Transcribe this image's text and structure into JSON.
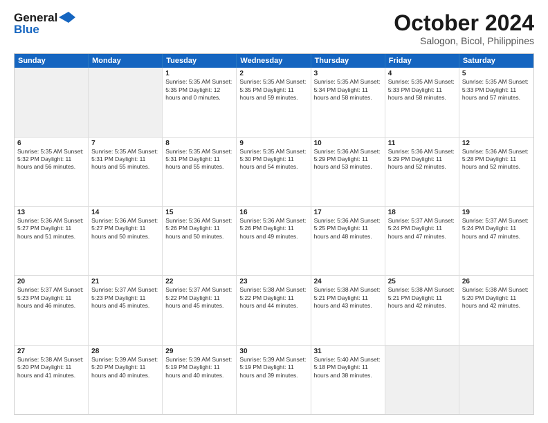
{
  "logo": {
    "line1": "General",
    "line2": "Blue"
  },
  "title": "October 2024",
  "subtitle": "Salogon, Bicol, Philippines",
  "weekdays": [
    "Sunday",
    "Monday",
    "Tuesday",
    "Wednesday",
    "Thursday",
    "Friday",
    "Saturday"
  ],
  "rows": [
    [
      {
        "day": "",
        "text": "",
        "shaded": true
      },
      {
        "day": "",
        "text": "",
        "shaded": true
      },
      {
        "day": "1",
        "text": "Sunrise: 5:35 AM\nSunset: 5:35 PM\nDaylight: 12 hours\nand 0 minutes."
      },
      {
        "day": "2",
        "text": "Sunrise: 5:35 AM\nSunset: 5:35 PM\nDaylight: 11 hours\nand 59 minutes."
      },
      {
        "day": "3",
        "text": "Sunrise: 5:35 AM\nSunset: 5:34 PM\nDaylight: 11 hours\nand 58 minutes."
      },
      {
        "day": "4",
        "text": "Sunrise: 5:35 AM\nSunset: 5:33 PM\nDaylight: 11 hours\nand 58 minutes."
      },
      {
        "day": "5",
        "text": "Sunrise: 5:35 AM\nSunset: 5:33 PM\nDaylight: 11 hours\nand 57 minutes."
      }
    ],
    [
      {
        "day": "6",
        "text": "Sunrise: 5:35 AM\nSunset: 5:32 PM\nDaylight: 11 hours\nand 56 minutes."
      },
      {
        "day": "7",
        "text": "Sunrise: 5:35 AM\nSunset: 5:31 PM\nDaylight: 11 hours\nand 55 minutes."
      },
      {
        "day": "8",
        "text": "Sunrise: 5:35 AM\nSunset: 5:31 PM\nDaylight: 11 hours\nand 55 minutes."
      },
      {
        "day": "9",
        "text": "Sunrise: 5:35 AM\nSunset: 5:30 PM\nDaylight: 11 hours\nand 54 minutes."
      },
      {
        "day": "10",
        "text": "Sunrise: 5:36 AM\nSunset: 5:29 PM\nDaylight: 11 hours\nand 53 minutes."
      },
      {
        "day": "11",
        "text": "Sunrise: 5:36 AM\nSunset: 5:29 PM\nDaylight: 11 hours\nand 52 minutes."
      },
      {
        "day": "12",
        "text": "Sunrise: 5:36 AM\nSunset: 5:28 PM\nDaylight: 11 hours\nand 52 minutes."
      }
    ],
    [
      {
        "day": "13",
        "text": "Sunrise: 5:36 AM\nSunset: 5:27 PM\nDaylight: 11 hours\nand 51 minutes."
      },
      {
        "day": "14",
        "text": "Sunrise: 5:36 AM\nSunset: 5:27 PM\nDaylight: 11 hours\nand 50 minutes."
      },
      {
        "day": "15",
        "text": "Sunrise: 5:36 AM\nSunset: 5:26 PM\nDaylight: 11 hours\nand 50 minutes."
      },
      {
        "day": "16",
        "text": "Sunrise: 5:36 AM\nSunset: 5:26 PM\nDaylight: 11 hours\nand 49 minutes."
      },
      {
        "day": "17",
        "text": "Sunrise: 5:36 AM\nSunset: 5:25 PM\nDaylight: 11 hours\nand 48 minutes."
      },
      {
        "day": "18",
        "text": "Sunrise: 5:37 AM\nSunset: 5:24 PM\nDaylight: 11 hours\nand 47 minutes."
      },
      {
        "day": "19",
        "text": "Sunrise: 5:37 AM\nSunset: 5:24 PM\nDaylight: 11 hours\nand 47 minutes."
      }
    ],
    [
      {
        "day": "20",
        "text": "Sunrise: 5:37 AM\nSunset: 5:23 PM\nDaylight: 11 hours\nand 46 minutes."
      },
      {
        "day": "21",
        "text": "Sunrise: 5:37 AM\nSunset: 5:23 PM\nDaylight: 11 hours\nand 45 minutes."
      },
      {
        "day": "22",
        "text": "Sunrise: 5:37 AM\nSunset: 5:22 PM\nDaylight: 11 hours\nand 45 minutes."
      },
      {
        "day": "23",
        "text": "Sunrise: 5:38 AM\nSunset: 5:22 PM\nDaylight: 11 hours\nand 44 minutes."
      },
      {
        "day": "24",
        "text": "Sunrise: 5:38 AM\nSunset: 5:21 PM\nDaylight: 11 hours\nand 43 minutes."
      },
      {
        "day": "25",
        "text": "Sunrise: 5:38 AM\nSunset: 5:21 PM\nDaylight: 11 hours\nand 42 minutes."
      },
      {
        "day": "26",
        "text": "Sunrise: 5:38 AM\nSunset: 5:20 PM\nDaylight: 11 hours\nand 42 minutes."
      }
    ],
    [
      {
        "day": "27",
        "text": "Sunrise: 5:38 AM\nSunset: 5:20 PM\nDaylight: 11 hours\nand 41 minutes."
      },
      {
        "day": "28",
        "text": "Sunrise: 5:39 AM\nSunset: 5:20 PM\nDaylight: 11 hours\nand 40 minutes."
      },
      {
        "day": "29",
        "text": "Sunrise: 5:39 AM\nSunset: 5:19 PM\nDaylight: 11 hours\nand 40 minutes."
      },
      {
        "day": "30",
        "text": "Sunrise: 5:39 AM\nSunset: 5:19 PM\nDaylight: 11 hours\nand 39 minutes."
      },
      {
        "day": "31",
        "text": "Sunrise: 5:40 AM\nSunset: 5:18 PM\nDaylight: 11 hours\nand 38 minutes."
      },
      {
        "day": "",
        "text": "",
        "shaded": true
      },
      {
        "day": "",
        "text": "",
        "shaded": true
      }
    ]
  ]
}
